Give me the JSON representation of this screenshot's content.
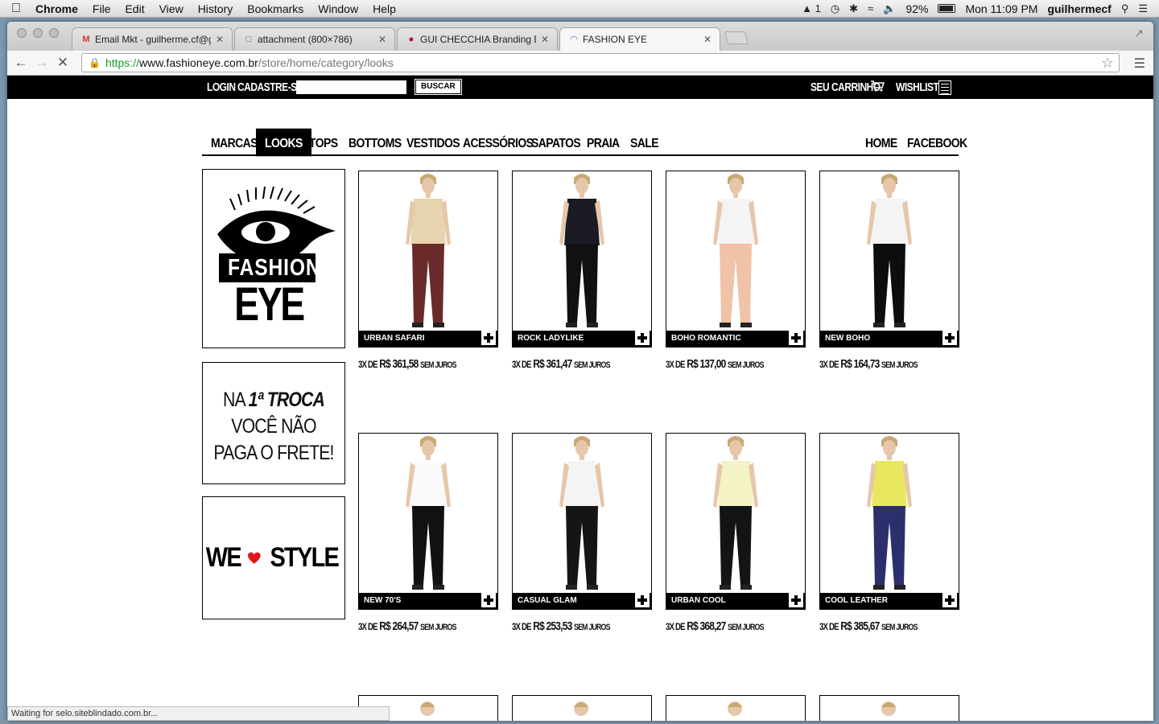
{
  "menubar": {
    "app": "Chrome",
    "items": [
      "File",
      "Edit",
      "View",
      "History",
      "Bookmarks",
      "Window",
      "Help"
    ],
    "adobe_count": "1",
    "battery": "92%",
    "clock": "Mon 11:09 PM",
    "user": "guilhermecf"
  },
  "tabs": [
    {
      "title": "Email Mkt - guilherme.cf@gm",
      "icon": "gmail-icon"
    },
    {
      "title": "attachment (800×786)",
      "icon": "document-icon"
    },
    {
      "title": "GUI CHECCHIA Branding Des",
      "icon": "avatar-icon"
    },
    {
      "title": "FASHION EYE",
      "icon": "loading-icon"
    }
  ],
  "address": {
    "scheme": "https://",
    "host": "www.fashioneye.com.br",
    "path": "/store/home/category/looks"
  },
  "site": {
    "login": "LOGIN",
    "signup": "CADASTRE-SE",
    "search_button": "BUSCAR",
    "cart": "SEU CARRINHO",
    "wishlist": "WISHLIST",
    "categories": [
      "MARCAS",
      "LOOKS",
      "TOPS",
      "BOTTOMS",
      "VESTIDOS",
      "ACESSÓRIOS",
      "SAPATOS",
      "PRAIA",
      "SALE"
    ],
    "active_category": "LOOKS",
    "right_links": [
      "HOME",
      "FACEBOOK"
    ],
    "logo_line1": "FASHION",
    "logo_line2": "EYE",
    "promo": {
      "l1a": "NA ",
      "l1b": "1ª TROCA",
      "l2": "VOCÊ NÃO",
      "l3": "PAGA O FRETE!"
    },
    "we": "WE",
    "style": "STYLE",
    "price_prefix": "3X DE",
    "price_suffix": "SEM JUROS"
  },
  "products": [
    {
      "name": "URBAN SAFARI",
      "price": "R$ 361,58",
      "top": "#e8d3b0",
      "bottom": "#6b2a2a"
    },
    {
      "name": "ROCK LADYLIKE",
      "price": "R$ 361,47",
      "top": "#1a1a22",
      "bottom": "#111111"
    },
    {
      "name": "BOHO ROMANTIC",
      "price": "R$ 137,00",
      "top": "#f4f4f4",
      "bottom": "#f0c2a8"
    },
    {
      "name": "NEW BOHO",
      "price": "R$ 164,73",
      "top": "#f4f4f4",
      "bottom": "#0d0d0d"
    },
    {
      "name": "NEW 70'S",
      "price": "R$ 264,57",
      "top": "#fafafa",
      "bottom": "#111111"
    },
    {
      "name": "CASUAL GLAM",
      "price": "R$ 253,53",
      "top": "#f4f4f4",
      "bottom": "#151515"
    },
    {
      "name": "URBAN COOL",
      "price": "R$ 368,27",
      "top": "#f3f3c6",
      "bottom": "#141414"
    },
    {
      "name": "COOL LEATHER",
      "price": "R$ 385,67",
      "top": "#e8e860",
      "bottom": "#2b2f6b"
    }
  ],
  "status_text": "Waiting for selo.siteblindado.com.br..."
}
